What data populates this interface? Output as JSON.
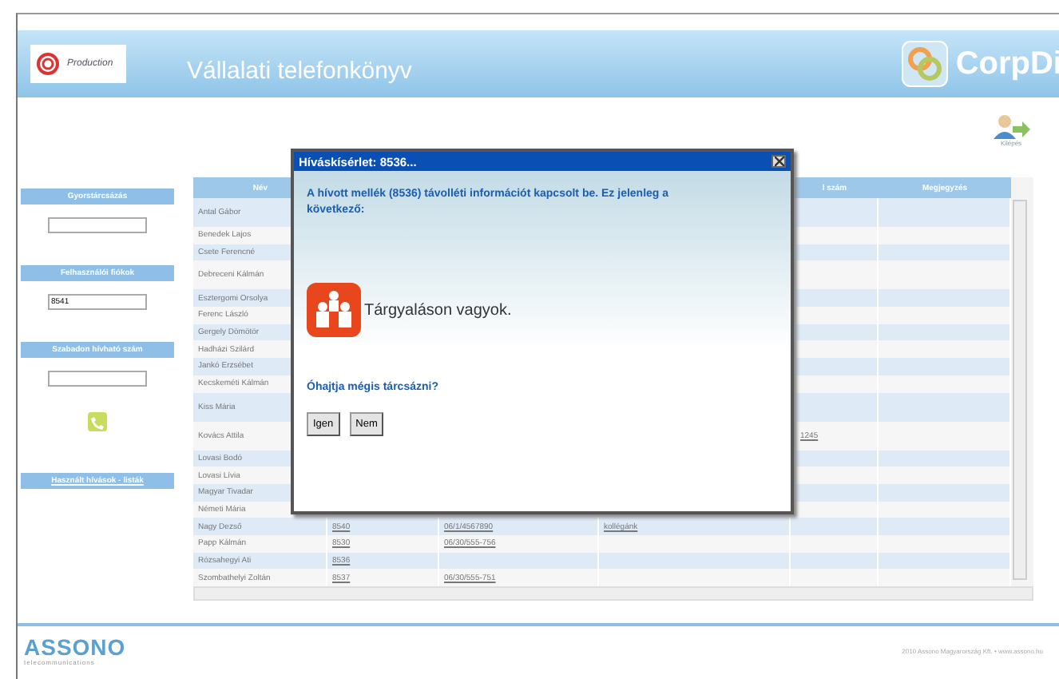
{
  "header": {
    "title": "Vállalati telefonkönyv",
    "brand": "CorpDi",
    "logo_text": "Production",
    "exit_label": "Kilépés"
  },
  "sidebar": {
    "sections": [
      {
        "kind": "field",
        "title": "Gyorstárcsázás"
      },
      {
        "kind": "field",
        "title": "Felhasználói fiókok",
        "value": "8541"
      },
      {
        "kind": "call",
        "title": "Szabadon hívható szám"
      },
      {
        "kind": "link",
        "title": "Használt hívások - listák"
      }
    ]
  },
  "table": {
    "columns": [
      "Név",
      "",
      "",
      "",
      "l szám",
      "Megjegyzés"
    ],
    "rows": [
      {
        "name": "Antal Gábor",
        "tall": true
      },
      {
        "name": "Benedek Lajos"
      },
      {
        "name": "Csete Ferencné"
      },
      {
        "name": "Debreceni Kálmán",
        "tall": true
      },
      {
        "name": "Esztergomi Orsolya"
      },
      {
        "name": "Ferenc László"
      },
      {
        "name": "Gergely Dömötör"
      },
      {
        "name": "Hadházi Szilárd"
      },
      {
        "name": "Jankó Erzsébet"
      },
      {
        "name": "Kecskeméti Kálmán"
      },
      {
        "name": "Kiss Mária",
        "tall": true
      },
      {
        "name": "Kovács Attila",
        "tall": true,
        "column_5": "1245"
      },
      {
        "name": "Lovasi Bodó"
      },
      {
        "name": "Lovasi Lívia"
      },
      {
        "name": "Magyar Tivadar"
      },
      {
        "name": "Németi Mária"
      },
      {
        "name": "Nagy Dezső",
        "column_2": "8540",
        "column_3": "06/1/4567890",
        "column_4": "kollégánk"
      },
      {
        "name": "Papp Kálmán",
        "column_2": "8530",
        "column_3": "06/30/555-756"
      },
      {
        "name": "Rózsahegyi Ati",
        "column_2": "8536"
      },
      {
        "name": "Szombathelyi Zoltán",
        "column_2": "8537",
        "column_3": "06/30/555-751"
      }
    ]
  },
  "dialog": {
    "title": "Híváskísérlet: 8536...",
    "message": "A hívott mellék (8536) távolléti információt kapcsolt be. Ez jelenleg a következő:",
    "status": "Tárgyaláson vagyok.",
    "question": "Óhajtja mégis tárcsázni?",
    "buttons": [
      "Igen",
      "Nem"
    ]
  },
  "footer": {
    "logo": "ASSONO",
    "logo_sub": "telecommunications",
    "copyright": "2010 Assono Magyarország Kft. • www.assono.hu"
  }
}
